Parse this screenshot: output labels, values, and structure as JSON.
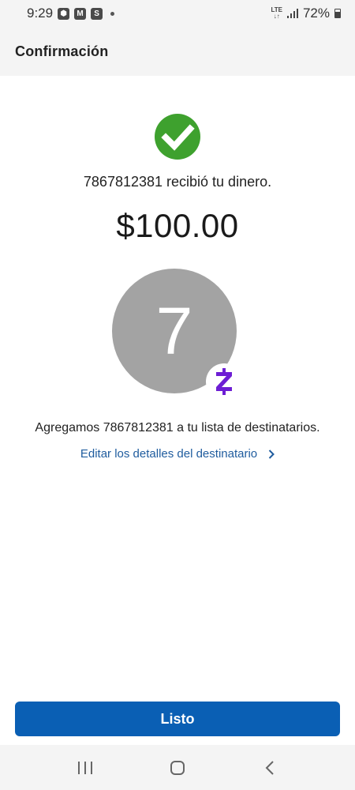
{
  "status_bar": {
    "time": "9:29",
    "network": "LTE",
    "battery": "72%"
  },
  "header": {
    "title": "Confirmación"
  },
  "confirmation": {
    "received_message": "7867812381 recibió tu dinero.",
    "amount": "$100.00",
    "avatar_initial": "7",
    "added_message": "Agregamos 7867812381 a tu lista de destinatarios.",
    "edit_link_label": "Editar los detalles del destinatario"
  },
  "actions": {
    "done_label": "Listo"
  },
  "colors": {
    "success_green": "#3ea12e",
    "primary_blue": "#0a5fb4",
    "link_blue": "#1f5c9e",
    "zelle_purple": "#6d1ed4",
    "avatar_gray": "#a3a3a3"
  },
  "icons": {
    "status": [
      "chase-icon",
      "gmail-icon",
      "s-app-icon",
      "notification-dot-icon",
      "signal-icon",
      "battery-icon"
    ],
    "content": [
      "check-icon",
      "zelle-icon",
      "chevron-right-icon"
    ],
    "nav": [
      "recent-apps-icon",
      "home-icon",
      "back-icon"
    ]
  }
}
